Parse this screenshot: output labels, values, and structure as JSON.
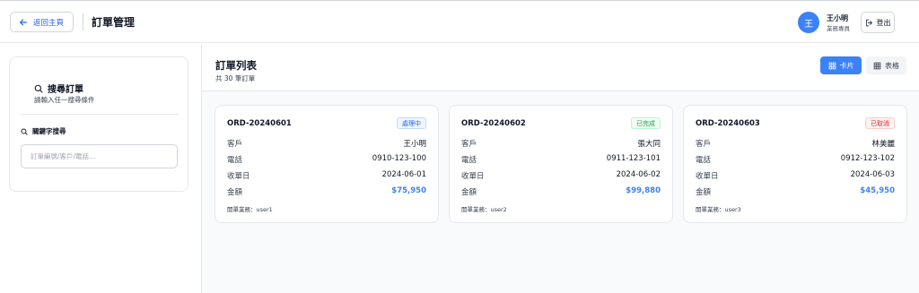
{
  "header": {
    "back_label": "返回主頁",
    "title": "訂單管理",
    "avatar_initial": "王",
    "user_name": "王小明",
    "user_role": "業務專員",
    "logout_label": "登出"
  },
  "sidebar": {
    "search_title": "搜尋訂單",
    "search_subtitle": "請輸入任一搜尋條件",
    "keyword_label": "關鍵字搜尋",
    "keyword_placeholder": "訂單編號/客戶/電話...",
    "keyword_value": ""
  },
  "main": {
    "list_title": "訂單列表",
    "count_text": "共 30 筆訂單",
    "view_card_label": "卡片",
    "view_table_label": "表格",
    "field_labels": {
      "customer": "客戶",
      "phone": "電話",
      "date": "收單日",
      "amount": "金額"
    },
    "orders": [
      {
        "id": "ORD-20240601",
        "status": "處理中",
        "customer": "王小明",
        "phone": "0910-123-100",
        "date": "2024-06-01",
        "amount": "$75,950",
        "sales": "開單業務：user1"
      },
      {
        "id": "ORD-20240602",
        "status": "已完成",
        "customer": "張大同",
        "phone": "0911-123-101",
        "date": "2024-06-02",
        "amount": "$99,880",
        "sales": "開單業務：user2"
      },
      {
        "id": "ORD-20240603",
        "status": "已取消",
        "customer": "林美麗",
        "phone": "0912-123-102",
        "date": "2024-06-03",
        "amount": "$45,950",
        "sales": "開單業務：user3"
      }
    ]
  },
  "colors": {
    "accent": "#3b82f6",
    "status_processing": "#2563eb",
    "status_done": "#16a34a",
    "status_cancel": "#dc2626"
  },
  "icons": [
    "arrow-left-icon",
    "logout-icon",
    "search-icon",
    "grid-icon",
    "table-icon"
  ]
}
